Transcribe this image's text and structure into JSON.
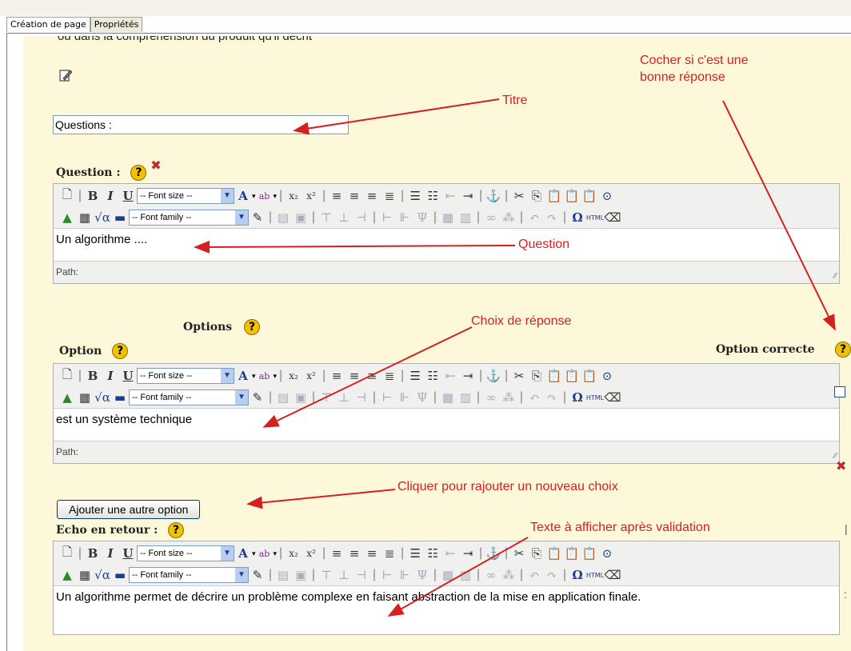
{
  "tabs": [
    {
      "label": "Création de page"
    },
    {
      "label": "Propriétés"
    }
  ],
  "header_cut_text": "ou dans la compréhension du produit qu'il décrit",
  "title_input": {
    "value": "Questions :"
  },
  "question": {
    "label": "Question :",
    "body": "Un algorithme ....",
    "path_label": "Path:"
  },
  "options": {
    "heading": "Options",
    "option_label": "Option",
    "correct_label": "Option correcte",
    "body": "est un système technique",
    "path_label": "Path:"
  },
  "add_option_button": "Ajouter une autre option",
  "feedback": {
    "label": "Echo en retour :",
    "body": "Un algorithme permet de décrire un problème complexe en faisant abstraction de la mise en application finale."
  },
  "toolbar": {
    "font_size": "-- Font size --",
    "font_family": "-- Font family --",
    "html_label": "HTML"
  },
  "help_glyph": "?",
  "annotations": {
    "titre": "Titre",
    "question": "Question",
    "cocher_line1": "Cocher si c'est une",
    "cocher_line2": "bonne réponse",
    "choix": "Choix de réponse",
    "cliquer": "Cliquer pour rajouter un nouveau choix",
    "texte": "Texte à afficher après validation"
  },
  "colors": {
    "annotation": "#d42020",
    "panel": "#fdf8da",
    "help": "#f2c200"
  }
}
